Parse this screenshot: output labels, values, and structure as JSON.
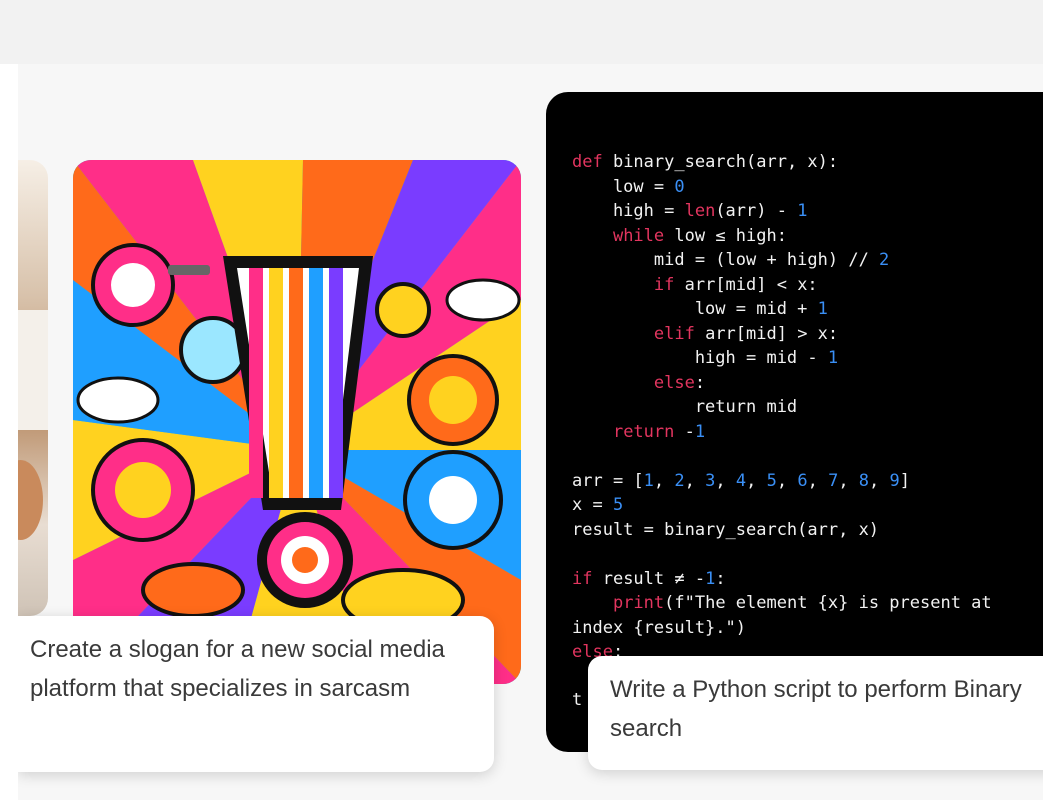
{
  "cards": [
    {
      "caption": "Create a slogan for a new social media platform that specializes in sarcasm"
    },
    {
      "caption": "Write a Python script to perform Binary search"
    }
  ],
  "code_lines": [
    [
      [
        "kw",
        "def"
      ],
      [
        "t",
        " binary_search(arr, x):"
      ]
    ],
    [
      [
        "t",
        "    low = "
      ],
      [
        "num",
        "0"
      ]
    ],
    [
      [
        "t",
        "    high = "
      ],
      [
        "kw",
        "len"
      ],
      [
        "t",
        "(arr) - "
      ],
      [
        "num",
        "1"
      ]
    ],
    [
      [
        "t",
        "    "
      ],
      [
        "kw",
        "while"
      ],
      [
        "t",
        " low ≤ high:"
      ]
    ],
    [
      [
        "t",
        "        mid = (low + high) // "
      ],
      [
        "num",
        "2"
      ]
    ],
    [
      [
        "t",
        "        "
      ],
      [
        "kw",
        "if"
      ],
      [
        "t",
        " arr[mid] < x:"
      ]
    ],
    [
      [
        "t",
        "            low = mid + "
      ],
      [
        "num",
        "1"
      ]
    ],
    [
      [
        "t",
        "        "
      ],
      [
        "kw",
        "elif"
      ],
      [
        "t",
        " arr[mid] > x:"
      ]
    ],
    [
      [
        "t",
        "            high = mid - "
      ],
      [
        "num",
        "1"
      ]
    ],
    [
      [
        "t",
        "        "
      ],
      [
        "kw",
        "else"
      ],
      [
        "t",
        ":"
      ]
    ],
    [
      [
        "t",
        "            return mid"
      ]
    ],
    [
      [
        "t",
        "    "
      ],
      [
        "kw",
        "return"
      ],
      [
        "t",
        " -"
      ],
      [
        "num",
        "1"
      ]
    ],
    [
      [
        "t",
        ""
      ]
    ],
    [
      [
        "t",
        "arr = ["
      ],
      [
        "num",
        "1"
      ],
      [
        "t",
        ", "
      ],
      [
        "num",
        "2"
      ],
      [
        "t",
        ", "
      ],
      [
        "num",
        "3"
      ],
      [
        "t",
        ", "
      ],
      [
        "num",
        "4"
      ],
      [
        "t",
        ", "
      ],
      [
        "num",
        "5"
      ],
      [
        "t",
        ", "
      ],
      [
        "num",
        "6"
      ],
      [
        "t",
        ", "
      ],
      [
        "num",
        "7"
      ],
      [
        "t",
        ", "
      ],
      [
        "num",
        "8"
      ],
      [
        "t",
        ", "
      ],
      [
        "num",
        "9"
      ],
      [
        "t",
        "]"
      ]
    ],
    [
      [
        "t",
        "x = "
      ],
      [
        "num",
        "5"
      ]
    ],
    [
      [
        "t",
        "result = binary_search(arr, x)"
      ]
    ],
    [
      [
        "t",
        ""
      ]
    ],
    [
      [
        "kw",
        "if"
      ],
      [
        "t",
        " result ≠ -"
      ],
      [
        "num",
        "1"
      ],
      [
        "t",
        ":"
      ]
    ],
    [
      [
        "t",
        "    "
      ],
      [
        "kw",
        "print"
      ],
      [
        "t",
        "(f\"The element {x} is present at"
      ]
    ],
    [
      [
        "t",
        "index {result}.\")"
      ]
    ],
    [
      [
        "kw",
        "else"
      ],
      [
        "t",
        ":"
      ]
    ]
  ],
  "code_stub": "t"
}
